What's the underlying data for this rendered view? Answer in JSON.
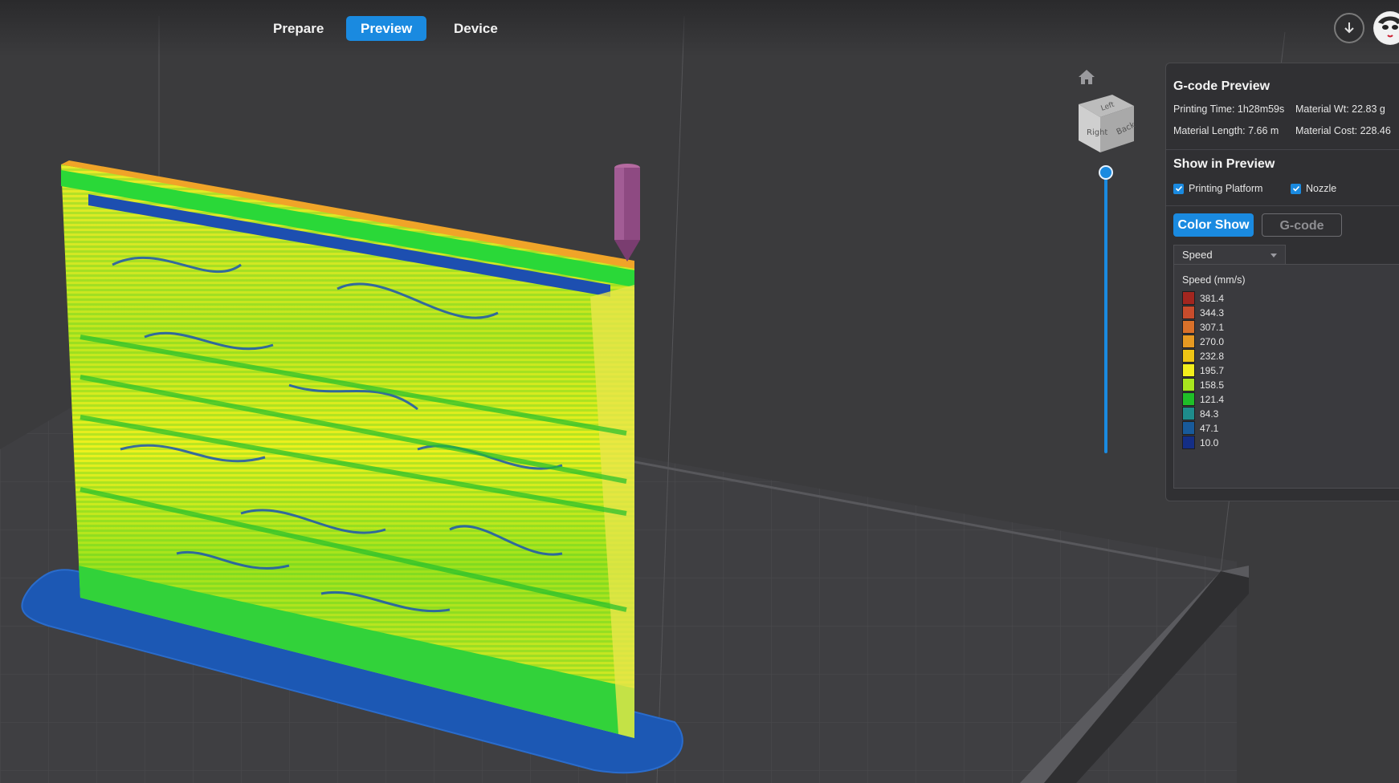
{
  "top_tabs": {
    "prepare": "Prepare",
    "preview": "Preview",
    "device": "Device"
  },
  "view_cube": {
    "right": "Right",
    "back": "Back",
    "left": "Left"
  },
  "gcode_preview": {
    "title": "G-code Preview",
    "printing_time": "Printing Time: 1h28m59s",
    "material_wt": "Material Wt: 22.83 g",
    "material_length": "Material Length: 7.66 m",
    "material_cost": "Material Cost: 228.46"
  },
  "show_in_preview": {
    "title": "Show in Preview",
    "printing_platform": "Printing Platform",
    "nozzle": "Nozzle",
    "printing_platform_checked": true,
    "nozzle_checked": true
  },
  "buttons": {
    "color_show": "Color Show",
    "gcode": "G-code"
  },
  "color_mode": {
    "selected": "Speed"
  },
  "legend": {
    "title": "Speed (mm/s)",
    "items": [
      {
        "value": "381.4",
        "color": "#a2261f"
      },
      {
        "value": "344.3",
        "color": "#c84c2c"
      },
      {
        "value": "307.1",
        "color": "#d9712a"
      },
      {
        "value": "270.0",
        "color": "#e69a22"
      },
      {
        "value": "232.8",
        "color": "#eec414"
      },
      {
        "value": "195.7",
        "color": "#f2ee1c"
      },
      {
        "value": "158.5",
        "color": "#a8e61e"
      },
      {
        "value": "121.4",
        "color": "#1fbf28"
      },
      {
        "value": "84.3",
        "color": "#1e8c8c"
      },
      {
        "value": "47.1",
        "color": "#185a9a"
      },
      {
        "value": "10.0",
        "color": "#142e86"
      }
    ]
  },
  "layer_slider": {
    "position": 1.0
  },
  "colors": {
    "accent": "#1a8ae0",
    "background": "#3b3b3d",
    "panel": "#303033"
  },
  "icons": {
    "download": "download-icon",
    "home": "home-icon",
    "checkbox": "check-icon"
  }
}
